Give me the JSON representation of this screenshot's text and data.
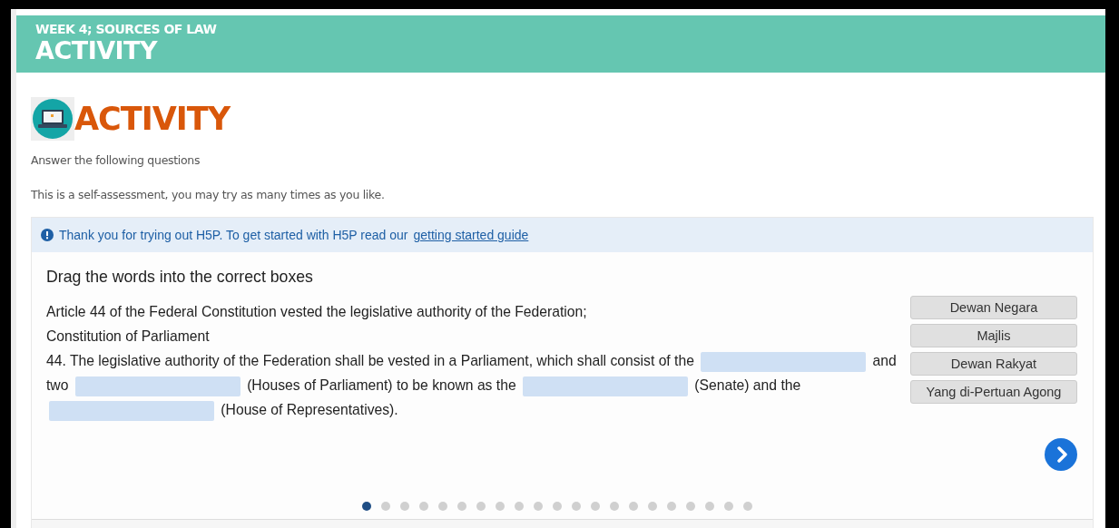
{
  "header": {
    "subtitle": "WEEK 4; SOURCES OF LAW",
    "title": "ACTIVITY"
  },
  "heading": "ACTIVITY",
  "intro": [
    "Answer the following questions",
    "This is a self-assessment, you may try as many times as you like."
  ],
  "notice": {
    "text": "Thank you for trying out H5P. To get started with H5P read our",
    "link": "getting started guide"
  },
  "task": {
    "instruction": "Drag the words into the correct boxes",
    "lines": [
      [
        {
          "kind": "text",
          "text": "Article 44 of the Federal Constitution vested the legislative authority of the Federation;"
        }
      ],
      [
        {
          "kind": "text",
          "text": "Constitution of Parliament"
        }
      ],
      [
        {
          "kind": "text",
          "text": "44. The legislative authority of the Federation shall be vested in a Parliament, which shall consist of the"
        },
        {
          "kind": "blank"
        },
        {
          "kind": "text",
          "text": "and"
        },
        {
          "kind": "text",
          "text": "two"
        },
        {
          "kind": "blank"
        },
        {
          "kind": "text",
          "text": "(Houses of Parliament) to be known as the"
        },
        {
          "kind": "blank"
        },
        {
          "kind": "text",
          "text": "(Senate) and the"
        },
        {
          "kind": "blank"
        },
        {
          "kind": "text",
          "text": "(House of Representatives)."
        }
      ]
    ],
    "words": [
      "Dewan Negara",
      "Majlis",
      "Dewan Rakyat",
      "Yang di-Pertuan Agong"
    ]
  },
  "pages": [
    {
      "selected": true
    },
    {
      "selected": false
    },
    {
      "selected": false
    },
    {
      "selected": false
    },
    {
      "selected": false
    },
    {
      "selected": false
    },
    {
      "selected": false
    },
    {
      "selected": false
    },
    {
      "selected": false
    },
    {
      "selected": false
    },
    {
      "selected": false
    },
    {
      "selected": false
    },
    {
      "selected": false
    },
    {
      "selected": false
    },
    {
      "selected": false
    },
    {
      "selected": false
    },
    {
      "selected": false
    },
    {
      "selected": false
    },
    {
      "selected": false
    },
    {
      "selected": false
    },
    {
      "selected": false
    }
  ]
}
